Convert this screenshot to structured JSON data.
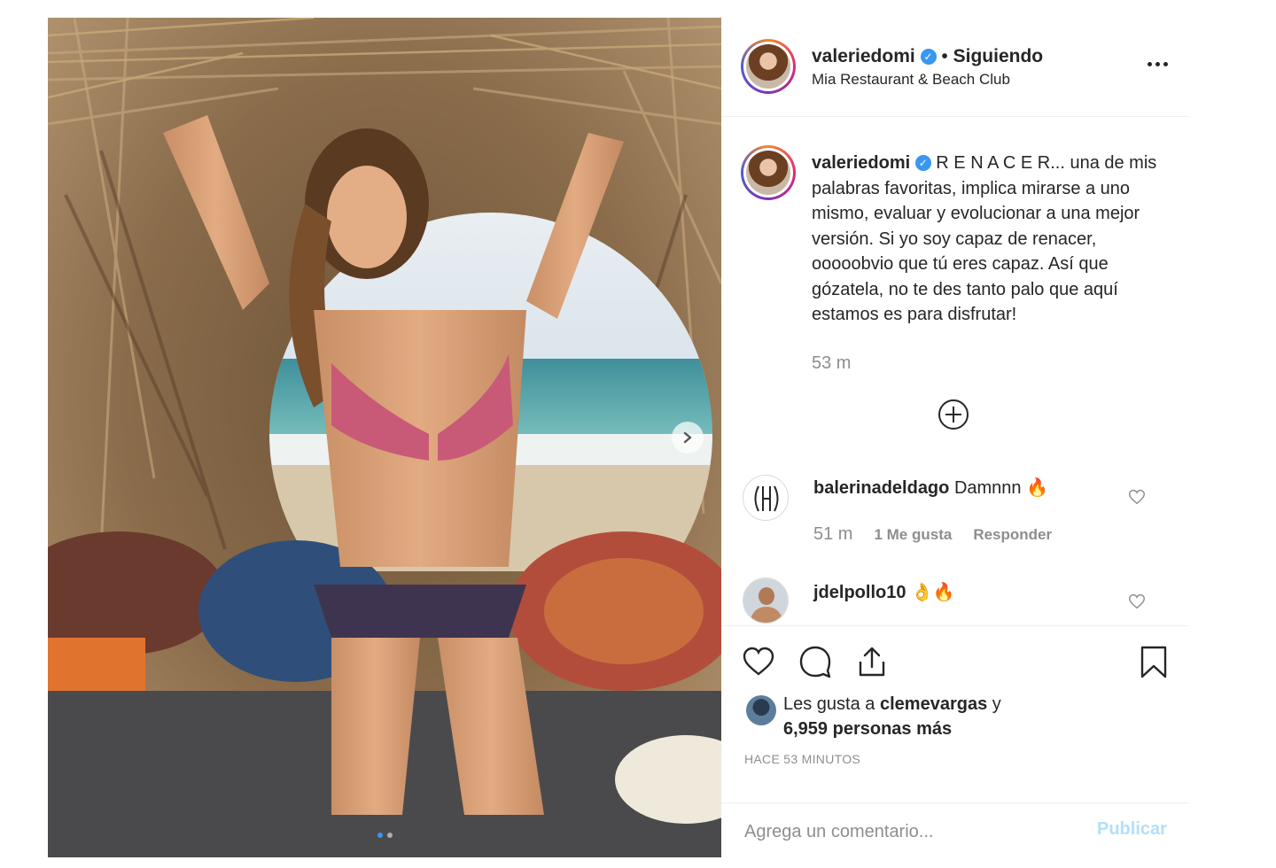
{
  "post": {
    "username": "valeriedomi",
    "verified_icon": "verified-badge-icon",
    "follow_status": "Siguiendo",
    "separator": "•",
    "location": "Mia Restaurant & Beach Club",
    "more_icon": "more-options-icon",
    "carousel_next_icon": "chevron-right-icon"
  },
  "caption": {
    "username": "valeriedomi",
    "text": "R E N A C E R... una de mis palabras favoritas, implica mirarse a uno mismo, evaluar y evolucionar a una mejor versión. Si yo soy capaz de renacer, ooooobvio que tú eres capaz. Así que gózatela, no te des tanto palo que aquí estamos es para disfrutar!",
    "time": "53 m"
  },
  "load_more_icon": "plus-circle-icon",
  "comments": [
    {
      "username": "balerinadeldago",
      "text": "Damnnn 🔥",
      "time": "51 m",
      "likes": "1 Me gusta",
      "reply_label": "Responder"
    },
    {
      "username": "jdelpollo10",
      "text": "👌🔥"
    }
  ],
  "actions": {
    "like_icon": "heart-icon",
    "comment_icon": "comment-icon",
    "share_icon": "share-icon",
    "save_icon": "bookmark-icon"
  },
  "likes": {
    "prefix": "Les gusta a",
    "user": "clemevargas",
    "conjunction": "y",
    "others": "6,959 personas más"
  },
  "posted_ago": "HACE 53 MINUTOS",
  "add_comment": {
    "placeholder": "Agrega un comentario...",
    "publish_label": "Publicar"
  },
  "colors": {
    "accent": "#3897f0",
    "publish_disabled": "#b2dffc",
    "muted": "#8e8e8e",
    "text": "#262626",
    "border": "#efefef"
  }
}
